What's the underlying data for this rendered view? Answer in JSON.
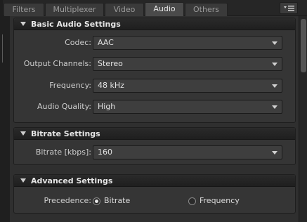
{
  "tabs": [
    {
      "label": "Filters",
      "active": false
    },
    {
      "label": "Multiplexer",
      "active": false
    },
    {
      "label": "Video",
      "active": false
    },
    {
      "label": "Audio",
      "active": true
    },
    {
      "label": "Others",
      "active": false
    }
  ],
  "panel_menu_icon": "panel-menu-icon",
  "basic": {
    "title": "Basic Audio Settings",
    "codec_label": "Codec:",
    "codec_value": "AAC",
    "channels_label": "Output Channels:",
    "channels_value": "Stereo",
    "frequency_label": "Frequency:",
    "frequency_value": "48 kHz",
    "quality_label": "Audio Quality:",
    "quality_value": "High"
  },
  "bitrate": {
    "title": "Bitrate Settings",
    "label": "Bitrate [kbps]:",
    "value": "160"
  },
  "advanced": {
    "title": "Advanced Settings",
    "precedence_label": "Precedence:",
    "option_bitrate": "Bitrate",
    "option_frequency": "Frequency",
    "selected": "Bitrate"
  }
}
